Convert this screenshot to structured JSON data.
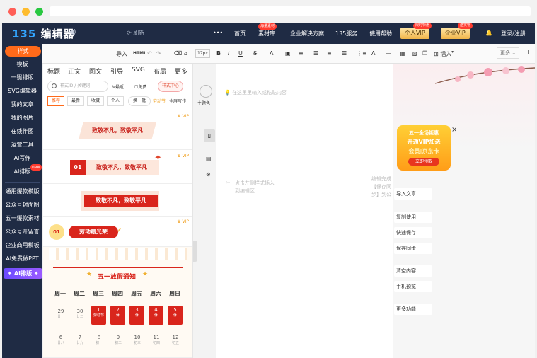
{
  "header": {
    "logo_num": "135",
    "logo_text": "编辑器",
    "refresh_label": "刷新",
    "more": "•••",
    "nav": [
      "首页",
      "素材库",
      "企业解决方案",
      "135服务",
      "使用帮助"
    ],
    "nav_tag": "海量素材",
    "personal_vip": "个人VIP",
    "personal_vip_tag": "限时特惠",
    "enterprise_vip": "企业VIP",
    "enterprise_vip_tag": "送实物",
    "login": "登录/注册"
  },
  "sidebar": {
    "active": "样式",
    "items": [
      "模板",
      "一键排版",
      "SVG编辑器",
      "我的文章",
      "我的图片",
      "在线作图",
      "运营工具",
      "AI写作",
      "AI排版"
    ],
    "new_badge": "new",
    "items2": [
      "通用爆款模版",
      "公众号封面图",
      "五一爆款素材",
      "公众号开留言",
      "企业商用模板",
      "AI免费做PPT"
    ],
    "ai_button": "✦ AI排版 ✦"
  },
  "toolbar": {
    "import": "导入",
    "html": "HTML",
    "font_size": "17px",
    "insert": "插入",
    "more": "更多"
  },
  "panel": {
    "tabs": [
      "标题",
      "正文",
      "图文",
      "引导",
      "SVG",
      "布局",
      "更多"
    ],
    "search_placeholder": "样式ID / 关键词",
    "latest": "最近",
    "free": "免费",
    "style_center": "样式中心",
    "chips": [
      "推荐",
      "最新",
      "收藏",
      "个人"
    ],
    "swap": "换一批",
    "festival": "劳动节",
    "fullscreen": "全屏写作",
    "vip": "VIP",
    "card1_title": "致敬不凡，致敬平凡",
    "card2_num": "01",
    "card2_title": "致敬不凡，致敬平凡",
    "card3_title": "致敬不凡，致敬平凡",
    "card4_num": "01",
    "card4_title": "劳动最光荣",
    "calendar": {
      "title": "五一放假通知",
      "weekdays": [
        "周一",
        "周二",
        "周三",
        "周四",
        "周五",
        "周六",
        "周日"
      ],
      "row1": [
        {
          "n": "29",
          "s": "廿一"
        },
        {
          "n": "30",
          "s": "廿二"
        },
        {
          "n": "1",
          "s": "劳动节"
        },
        {
          "n": "2",
          "s": "休"
        },
        {
          "n": "3",
          "s": "休"
        },
        {
          "n": "4",
          "s": "休"
        },
        {
          "n": "5",
          "s": "休"
        }
      ],
      "row2": [
        {
          "n": "6",
          "s": "廿八"
        },
        {
          "n": "7",
          "s": "廿九"
        },
        {
          "n": "8",
          "s": "初一"
        },
        {
          "n": "9",
          "s": "初二"
        },
        {
          "n": "10",
          "s": "初三"
        },
        {
          "n": "11",
          "s": "初四"
        },
        {
          "n": "12",
          "s": "初五"
        }
      ]
    }
  },
  "editor": {
    "theme_color": "主题色",
    "title_placeholder": "在这里里输入或粘贴内容",
    "hint_left": "点击左侧样式插入到编辑区",
    "hint_right": "编辑完成【保存同步】到公众号"
  },
  "right": {
    "buttons": [
      "导入文章",
      "复制使用",
      "快速保存",
      "保存同步",
      "清空内容",
      "手机预览",
      "更多功能"
    ],
    "ad_line1": "五一全场钜惠",
    "ad_line2": "开通VIP加送",
    "ad_line3": "会员|京东卡",
    "ad_button": "立即领取"
  },
  "colors": {
    "header_bg": "#1f2b44",
    "accent_orange": "#ff6a1a",
    "accent_red": "#d9251c",
    "vip_gold": "#f1b54b"
  }
}
